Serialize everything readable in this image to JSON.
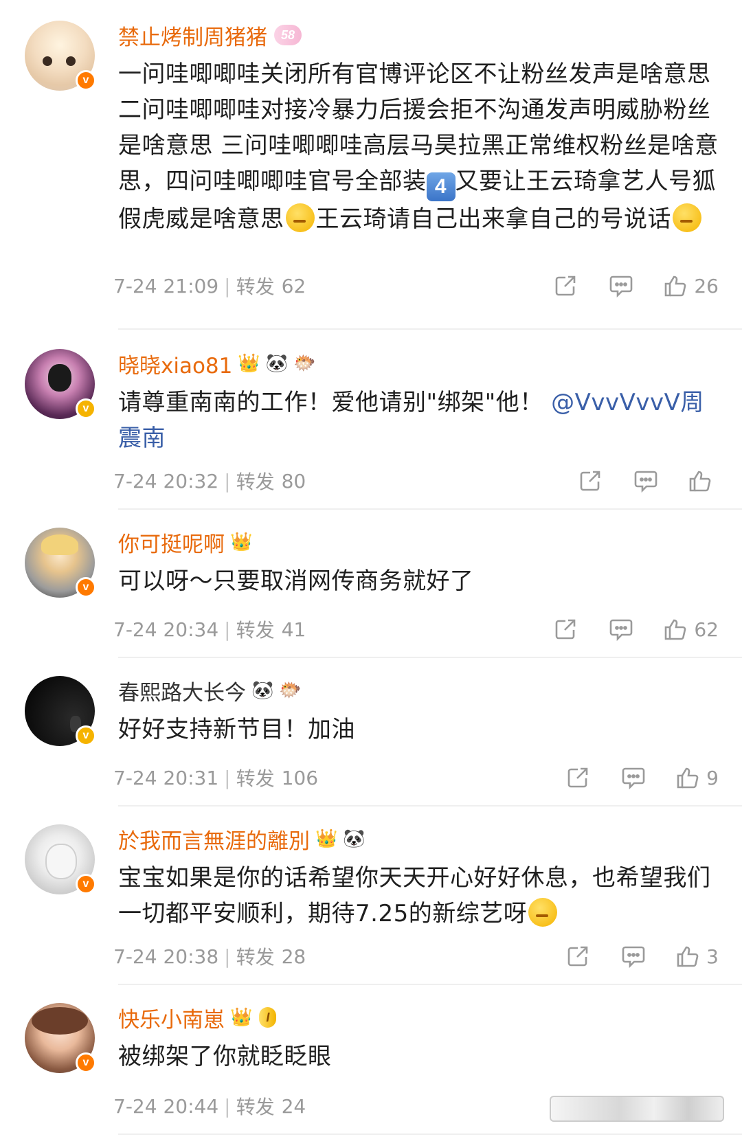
{
  "comments": [
    {
      "name": "禁止烤制周猪猪",
      "badge": "58",
      "text_parts": [
        "一问哇唧唧哇关闭所有官博评论区不让粉丝发声是啥意思 二问哇唧唧哇对接冷暴力后援会拒不沟通发声明威胁粉丝是啥意思 三问哇唧唧哇高层马昊拉黑正常维权粉丝是啥意思，四问哇唧唧哇官号全部装",
        "4",
        "又要让王云琦拿艺人号狐假虎威是啥意思",
        "王云琦请自己出来拿自己的号说话"
      ],
      "time": "7-24 21:09",
      "repost_label": "转发",
      "repost_count": "62",
      "likes": "26"
    },
    {
      "name": "晓晓xiao81",
      "text": "请尊重南南的工作！爱他请别\"绑架\"他！",
      "mention": "@VvvVvvV周震南",
      "time": "7-24 20:32",
      "repost_label": "转发",
      "repost_count": "80",
      "likes": ""
    },
    {
      "name": "你可挺呢啊",
      "text": "可以呀～只要取消网传商务就好了",
      "time": "7-24 20:34",
      "repost_label": "转发",
      "repost_count": "41",
      "likes": "62"
    },
    {
      "name": "春熙路大长今",
      "text": "好好支持新节目！加油",
      "time": "7-24 20:31",
      "repost_label": "转发",
      "repost_count": "106",
      "likes": "9"
    },
    {
      "name": "於我而言無涯的離別",
      "text": "宝宝如果是你的话希望你天天开心好好休息，也希望我们一切都平安顺利，期待7.25的新综艺呀",
      "time": "7-24 20:38",
      "repost_label": "转发",
      "repost_count": "28",
      "likes": "3"
    },
    {
      "name": "快乐小南崽",
      "badge": "I",
      "text": "被绑架了你就眨眨眼",
      "time": "7-24 20:44",
      "repost_label": "转发",
      "repost_count": "24",
      "likes": ""
    }
  ],
  "colors": {
    "name_vip": "#e86a0c",
    "name_plain": "#333333",
    "meta": "#9a9a9a",
    "mention": "#3a5fa8",
    "badge_orange": "#ff7a00",
    "badge_gold": "#f5b300"
  }
}
